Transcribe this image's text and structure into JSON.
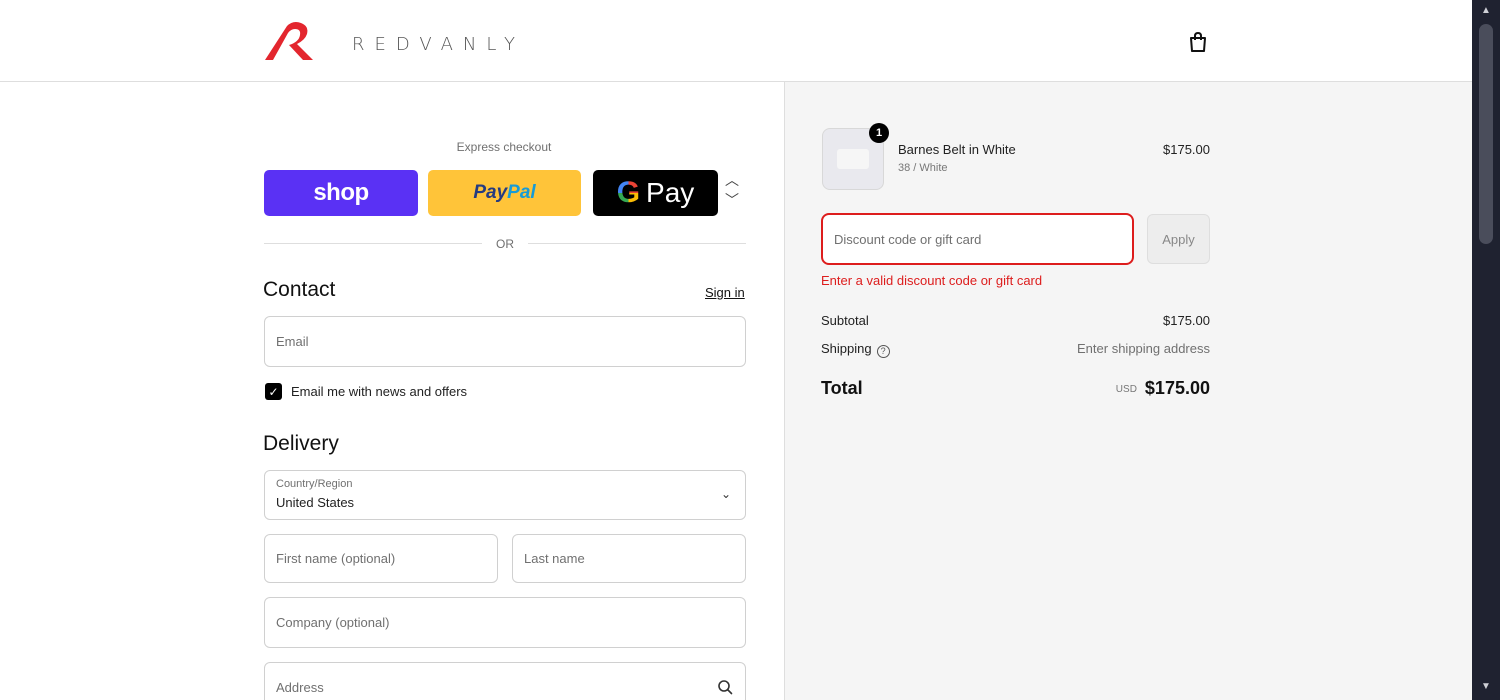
{
  "header": {
    "brand": "REDVANLY",
    "logo_icon": "redvanly-logo",
    "cart_icon": "shopping-bag-icon",
    "brand_color": "#e3262e"
  },
  "express": {
    "label": "Express checkout",
    "shop_label": "shop",
    "paypal_label_1": "Pay",
    "paypal_label_2": "Pal",
    "gpay_g": "G",
    "gpay_label": "Pay",
    "or_label": "OR"
  },
  "contact": {
    "title": "Contact",
    "sign_in": "Sign in",
    "email_placeholder": "Email",
    "newsletter_label": "Email me with news and offers",
    "newsletter_checked": true
  },
  "delivery": {
    "title": "Delivery",
    "country_label": "Country/Region",
    "country_value": "United States",
    "first_name_placeholder": "First name (optional)",
    "last_name_placeholder": "Last name",
    "company_placeholder": "Company (optional)",
    "address_placeholder": "Address"
  },
  "summary": {
    "item": {
      "name": "Barnes Belt in White",
      "variant": "38 / White",
      "price": "$175.00",
      "quantity": "1"
    },
    "discount_placeholder": "Discount code or gift card",
    "apply_label": "Apply",
    "discount_error": "Enter a valid discount code or gift card",
    "subtotal_label": "Subtotal",
    "subtotal_value": "$175.00",
    "shipping_label": "Shipping",
    "shipping_value": "Enter shipping address",
    "total_label": "Total",
    "currency": "USD",
    "total_value": "$175.00",
    "error_color": "#dd1d1d"
  }
}
